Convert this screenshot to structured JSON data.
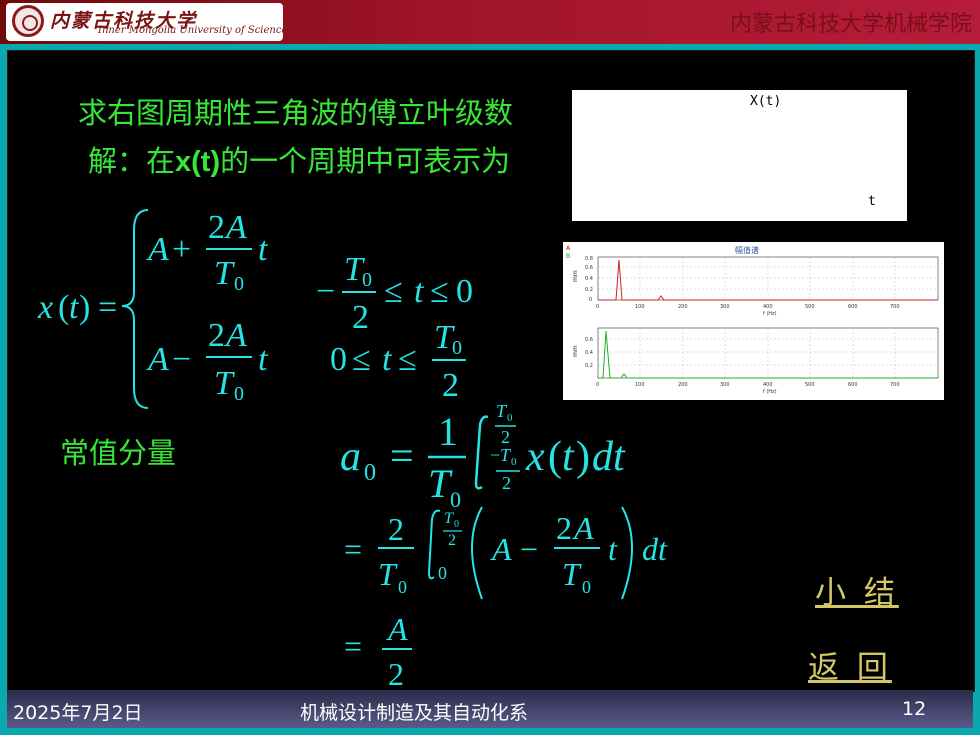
{
  "header": {
    "logo_cn": "内蒙古科技大学",
    "logo_en": "Inner Mongolia University of Science & Technology",
    "college": "内蒙古科技大学机械学院"
  },
  "slide": {
    "title_line1": "求右图周期性三角波的傅立叶级数",
    "title_line2_prefix": "解：在",
    "title_line2_var": "x(t)",
    "title_line2_suffix": "的一个周期中可表示为",
    "dc_label": "常值分量",
    "link_summary": "小 结",
    "link_back": "返  回"
  },
  "wave_figure": {
    "title": "X(t)",
    "xlabel": "t"
  },
  "spectrum_figure": {
    "title": "幅值谱",
    "legend": [
      "A",
      "B"
    ],
    "ylabel": "mm",
    "xlabel": "f (Hz)",
    "xticks": [
      "0",
      "100",
      "200",
      "300",
      "400",
      "500",
      "600",
      "700"
    ],
    "top_yticks": [
      "0.8",
      "0.6",
      "0.4",
      "0.2",
      "0"
    ],
    "bottom_yticks": [
      "0.6",
      "0.4",
      "0.2"
    ]
  },
  "footer": {
    "date": "2025年7月2日",
    "dept": "机械设计制造及其自动化系",
    "page": "12"
  },
  "colors": {
    "text_green": "#37e637",
    "formula_cyan": "#26e4e4",
    "link_gold": "#d4c766",
    "frame_teal": "#0aa9b0"
  }
}
